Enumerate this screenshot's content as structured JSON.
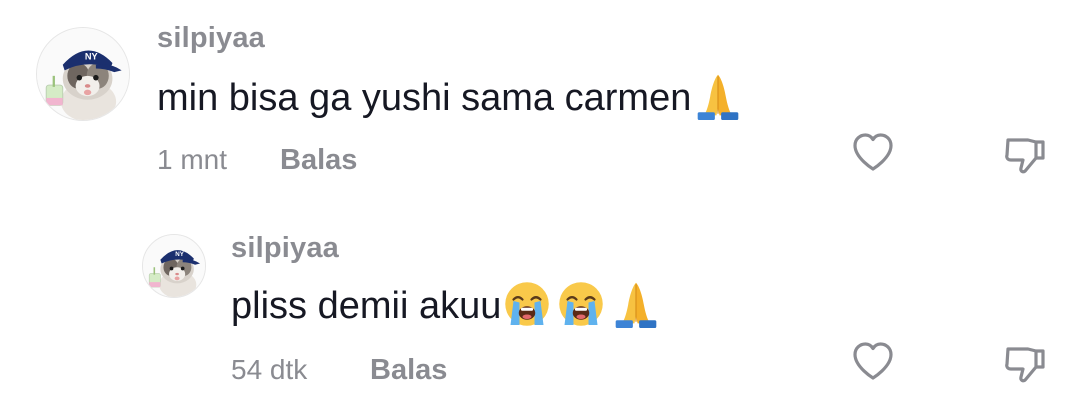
{
  "comments": [
    {
      "username": "silpiyaa",
      "text": "min bisa ga yushi sama carmen",
      "emojis": [
        "folded-hands"
      ],
      "time": "1 mnt",
      "reply_label": "Balas"
    },
    {
      "username": "silpiyaa",
      "text": "pliss demii akuu",
      "emojis": [
        "loudly-crying-face",
        "loudly-crying-face",
        "folded-hands"
      ],
      "time": "54 dtk",
      "reply_label": "Balas"
    }
  ],
  "colors": {
    "text": "#161823",
    "muted": "#8a8b91",
    "icon": "#8a8b91"
  },
  "icons": {
    "like": "heart-outline-icon",
    "dislike": "thumbs-down-icon"
  }
}
